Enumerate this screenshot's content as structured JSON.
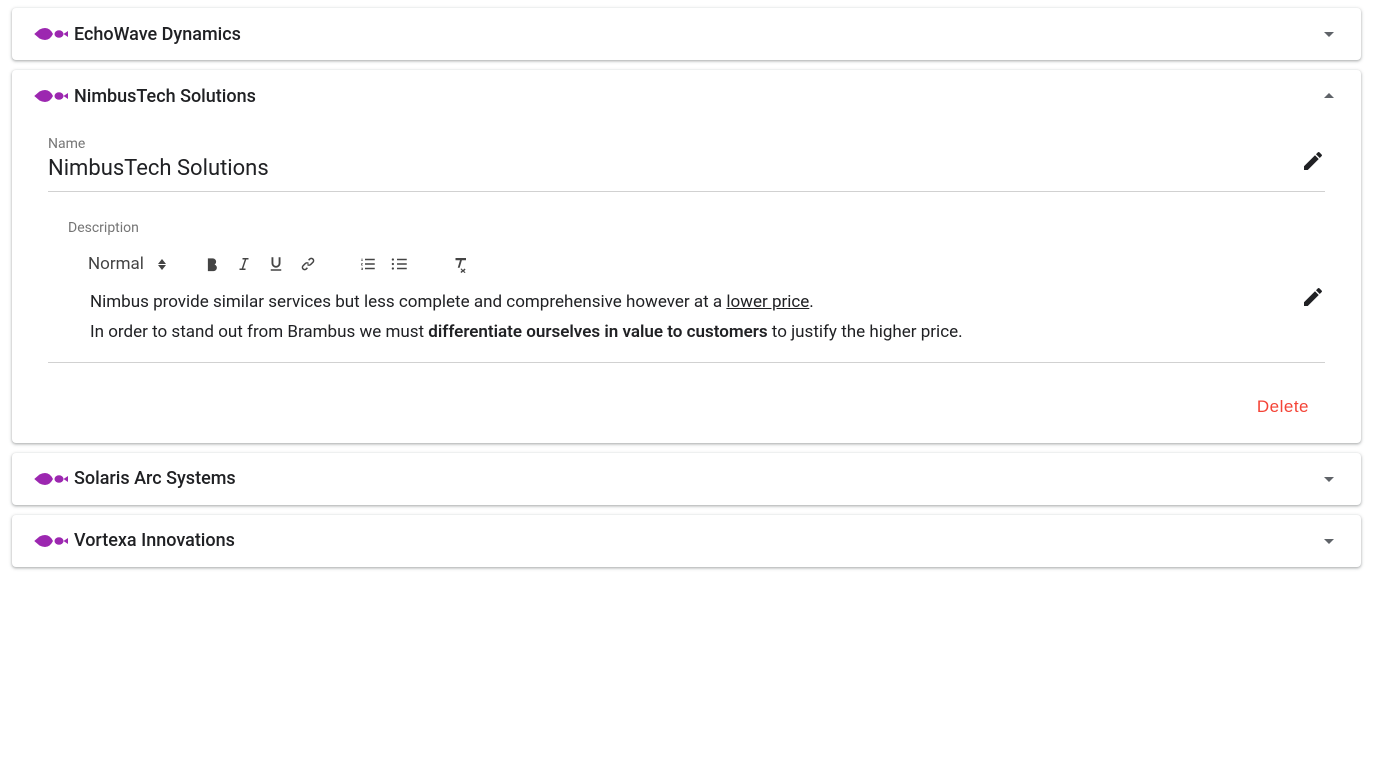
{
  "items": [
    {
      "title": "EchoWave Dynamics",
      "expanded": false
    },
    {
      "title": "NimbusTech Solutions",
      "expanded": true
    },
    {
      "title": "Solaris Arc Systems",
      "expanded": false
    },
    {
      "title": "Vortexa Innovations",
      "expanded": false
    }
  ],
  "expanded": {
    "name_label": "Name",
    "name_value": "NimbusTech Solutions",
    "desc_label": "Description",
    "format_select": "Normal",
    "desc_line1_a": "Nimbus provide similar services but less complete and comprehensive however at a ",
    "desc_line1_u": "lower price",
    "desc_line1_b": ".",
    "desc_line2_a": "In order to stand out from Brambus we must ",
    "desc_line2_bold": "differentiate ourselves in value to customers",
    "desc_line2_b": " to justify the higher price.",
    "delete_label": "Delete"
  },
  "colors": {
    "fish": "#9c27b0",
    "danger": "#f44336"
  }
}
